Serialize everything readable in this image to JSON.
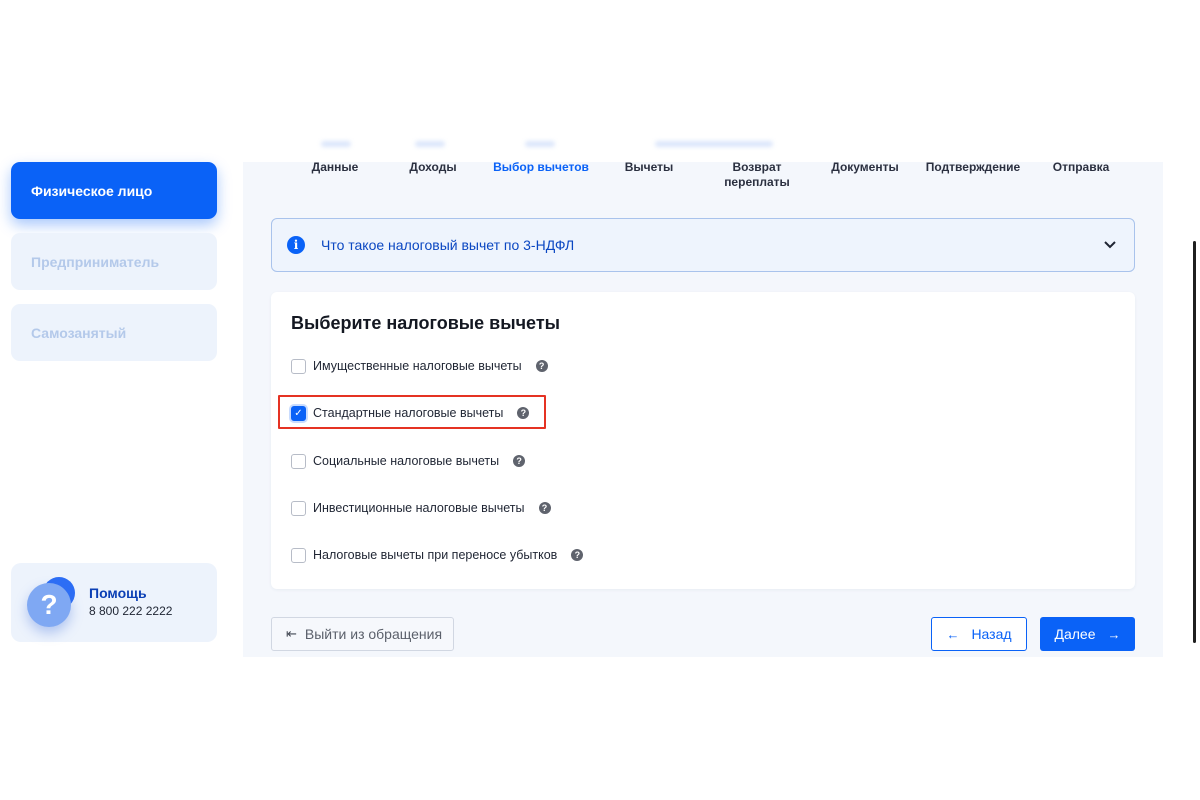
{
  "sidebar": {
    "items": [
      {
        "label": "Физическое лицо",
        "active": true
      },
      {
        "label": "Предприниматель",
        "active": false
      },
      {
        "label": "Самозанятый",
        "active": false
      }
    ],
    "help": {
      "title": "Помощь",
      "phone": "8 800 222 2222",
      "icon": "question-icon"
    }
  },
  "steps": [
    {
      "label": "Данные",
      "current": false
    },
    {
      "label": "Доходы",
      "current": false
    },
    {
      "label": "Выбор вычетов",
      "current": true
    },
    {
      "label": "Вычеты",
      "current": false
    },
    {
      "label": "Возврат переплаты",
      "current": false
    },
    {
      "label": "Документы",
      "current": false
    },
    {
      "label": "Подтверждение",
      "current": false
    },
    {
      "label": "Отправка",
      "current": false
    }
  ],
  "info": {
    "text": "Что такое налоговый вычет по 3-НДФЛ",
    "icon": "info-icon"
  },
  "card": {
    "title": "Выберите налоговые вычеты",
    "options": [
      {
        "label": "Имущественные налоговые вычеты",
        "checked": false
      },
      {
        "label": "Стандартные налоговые вычеты",
        "checked": true
      },
      {
        "label": "Социальные налоговые вычеты",
        "checked": false
      },
      {
        "label": "Инвестиционные налоговые вычеты",
        "checked": false
      },
      {
        "label": "Налоговые вычеты при переносе убытков",
        "checked": false
      }
    ]
  },
  "buttons": {
    "exit": "Выйти из обращения",
    "back": "Назад",
    "next": "Далее"
  },
  "colors": {
    "accent": "#0a62f7",
    "highlight": "#e53223",
    "sidebar_inactive_bg": "#edf3fc"
  }
}
